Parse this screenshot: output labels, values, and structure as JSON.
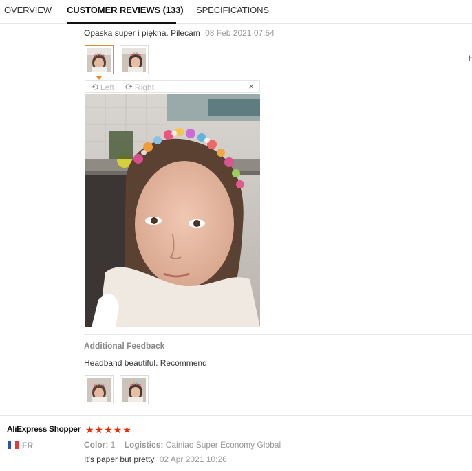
{
  "tabs": [
    {
      "label": "OVERVIEW"
    },
    {
      "label": "CUSTOMER REVIEWS (133)"
    },
    {
      "label": "SPECIFICATIONS"
    }
  ],
  "review1": {
    "text": "Opaska super i piękna. Pilecam",
    "date": "08 Feb 2021 07:54",
    "viewer": {
      "left_label": "Left",
      "right_label": "Right",
      "close_label": "×"
    },
    "additional_feedback_title": "Additional Feedback",
    "additional_text": "Headband beautiful. Recommend"
  },
  "side_letter": "H",
  "review2": {
    "author": "AliExpress Shopper",
    "stars": "★★★★★",
    "country": "FR",
    "color_label": "Color:",
    "color_value": "1",
    "logistics_label": "Logistics:",
    "logistics_value": "Cainiao Super Economy Global",
    "text": "It's paper but pretty",
    "date": "02 Apr 2021 10:26"
  },
  "colors": {
    "accent": "#e62e04",
    "selected_border": "#e28a2b"
  }
}
